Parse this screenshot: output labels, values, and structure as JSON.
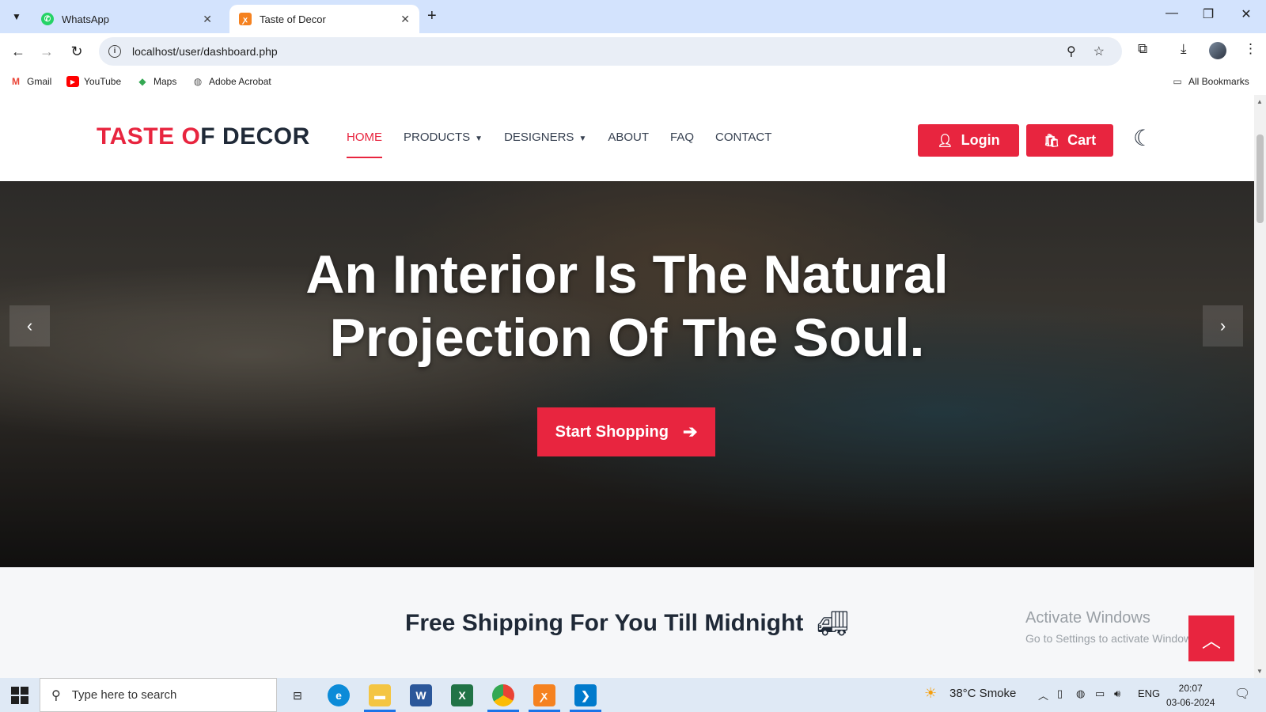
{
  "browser": {
    "tabs": [
      {
        "title": "WhatsApp",
        "active": false
      },
      {
        "title": "Taste of Decor",
        "active": true
      }
    ],
    "url": "localhost/user/dashboard.php",
    "bookmarks": [
      "Gmail",
      "YouTube",
      "Maps",
      "Adobe Acrobat"
    ],
    "all_bookmarks": "All Bookmarks"
  },
  "site": {
    "logo": {
      "part1": "TASTE O",
      "part2": "F DECOR"
    },
    "menu": [
      {
        "label": "HOME",
        "active": true
      },
      {
        "label": "PRODUCTS",
        "dropdown": true
      },
      {
        "label": "DESIGNERS",
        "dropdown": true
      },
      {
        "label": "ABOUT"
      },
      {
        "label": "FAQ"
      },
      {
        "label": "CONTACT"
      }
    ],
    "login_label": "Login",
    "cart_label": "Cart",
    "accent_color": "#e8253f"
  },
  "hero": {
    "title_line1": "An Interior Is The Natural",
    "title_line2": "Projection Of The Soul.",
    "button_label": "Start Shopping"
  },
  "shipping": {
    "text": "Free Shipping For You Till Midnight"
  },
  "watermark": {
    "line1": "Activate Windows",
    "line2": "Go to Settings to activate Windows."
  },
  "taskbar": {
    "search_placeholder": "Type here to search",
    "weather": "38°C  Smoke",
    "lang": "ENG",
    "time": "20:07",
    "date": "03-06-2024"
  }
}
